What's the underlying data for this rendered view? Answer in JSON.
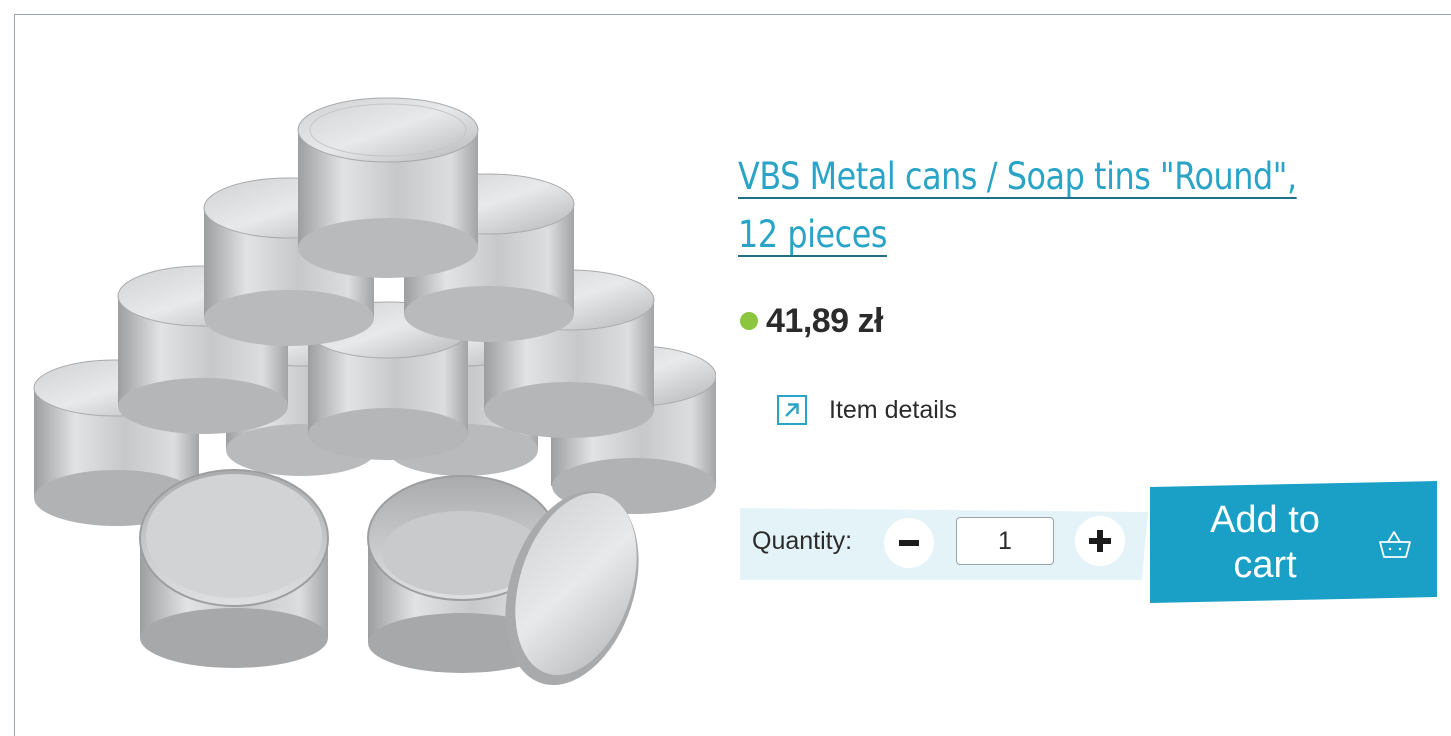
{
  "product": {
    "title": "VBS Metal cans / Soap tins \"Round\", 12 pieces",
    "price": "41,89 zł",
    "availability_color": "#8cc63f",
    "image_icon": "metal-tins-product-photo"
  },
  "details": {
    "label": "Item details",
    "icon": "external-arrow-icon"
  },
  "quantity": {
    "label": "Quantity:",
    "value": "1",
    "minus_icon": "minus-icon",
    "plus_icon": "plus-icon"
  },
  "cart": {
    "label_line1": "Add to",
    "label_line2": "cart",
    "icon": "basket-icon"
  },
  "colors": {
    "accent": "#1aa0c7",
    "link": "#2aa4c6",
    "panel": "#e4f3f8"
  }
}
